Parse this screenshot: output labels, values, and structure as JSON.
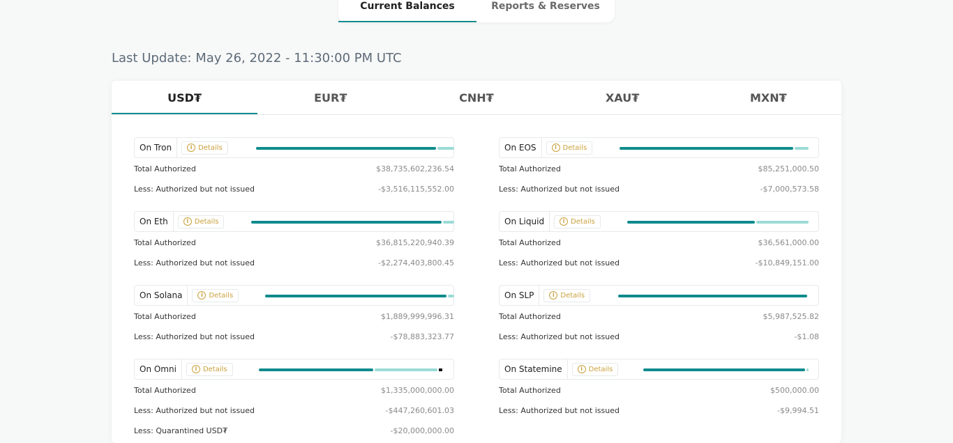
{
  "top_tabs": [
    {
      "label": "Current Balances"
    },
    {
      "label": "Reports & Reserves"
    }
  ],
  "last_update": "Last Update: May 26, 2022 - 11:30:00 PM UTC",
  "currency_tabs": [
    {
      "label": "USD₮"
    },
    {
      "label": "EUR₮"
    },
    {
      "label": "CNH₮"
    },
    {
      "label": "XAU₮"
    },
    {
      "label": "MXN₮"
    }
  ],
  "details_label": "Details",
  "row_labels": {
    "total": "Total Authorized",
    "less": "Less: Authorized but not issued",
    "quarantined": "Less: Quarantined USD₮"
  },
  "colors": {
    "accent": "#0f8b8d",
    "accent_light": "#9bdbd6",
    "details": "#c9a13b"
  },
  "left_chains": [
    {
      "name": "On Tron",
      "total": "$38,735,602,236.54",
      "less": "-$3,516,115,552.00",
      "issued_fraction": 0.909
    },
    {
      "name": "On Eth",
      "total": "$36,815,220,940.39",
      "less": "-$2,274,403,800.45",
      "issued_fraction": 0.938
    },
    {
      "name": "On Solana",
      "total": "$1,889,999,996.31",
      "less": "-$78,883,323.77",
      "issued_fraction": 0.958
    },
    {
      "name": "On Omni",
      "total": "$1,335,000,000.00",
      "less": "-$447,260,601.03",
      "quarantined": "-$20,000,000.00",
      "issued_fraction": 0.62
    }
  ],
  "right_chains": [
    {
      "name": "On EOS",
      "total": "$85,251,000.50",
      "less": "-$7,000,573.58",
      "issued_fraction": 0.918
    },
    {
      "name": "On Liquid",
      "total": "$36,561,000.00",
      "less": "-$10,849,151.00",
      "issued_fraction": 0.703
    },
    {
      "name": "On SLP",
      "total": "$5,987,525.82",
      "less": "-$1.08",
      "issued_fraction": 1.0
    },
    {
      "name": "On Statemine",
      "total": "$500,000.00",
      "less": "-$9,994.51",
      "issued_fraction": 0.98
    }
  ]
}
